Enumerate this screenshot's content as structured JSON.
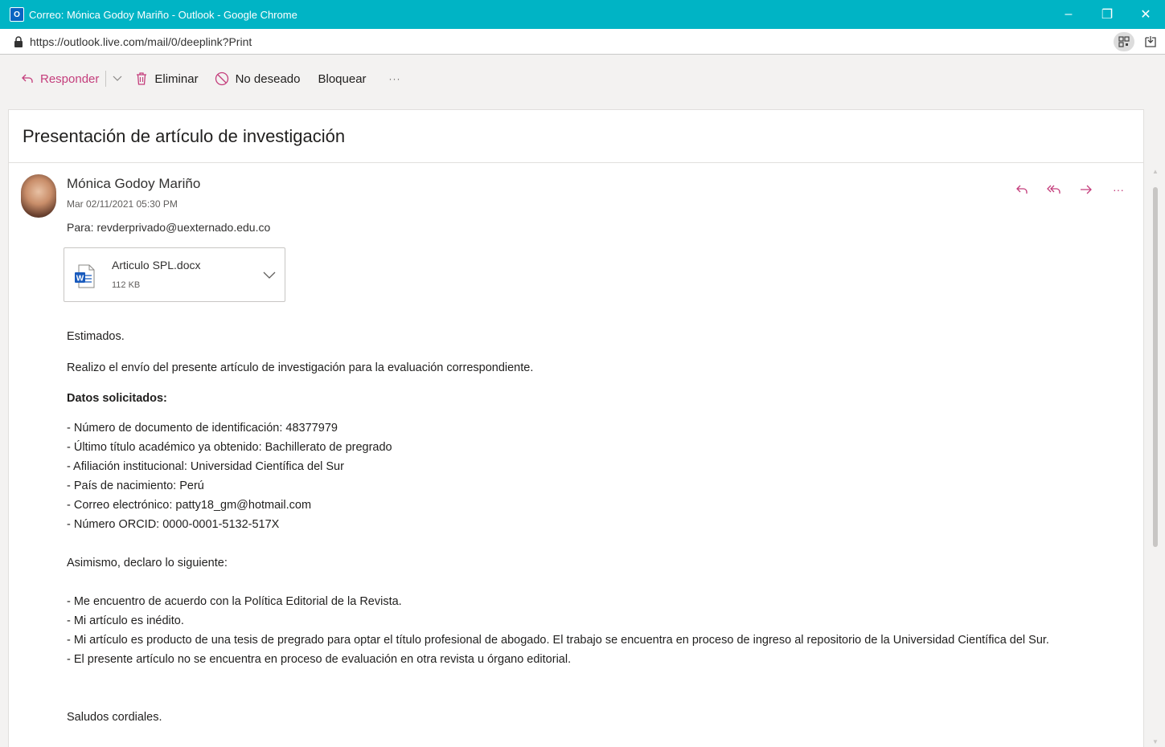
{
  "window": {
    "title": "Correo: Mónica Godoy Mariño - Outlook - Google Chrome",
    "app_icon": "O",
    "minimize": "–",
    "restore": "❐",
    "close": "✕"
  },
  "address_bar": {
    "url": "https://outlook.live.com/mail/0/deeplink?Print"
  },
  "toolbar": {
    "reply_label": "Responder",
    "delete_label": "Eliminar",
    "junk_label": "No deseado",
    "block_label": "Bloquear",
    "more_label": "···"
  },
  "message": {
    "subject": "Presentación de artículo de investigación",
    "sender": "Mónica Godoy Mariño",
    "date": "Mar 02/11/2021 05:30 PM",
    "to_label": "Para:",
    "to_value": "revderprivado@uexternado.edu.co",
    "more_actions": "···",
    "attachment": {
      "name": "Articulo SPL.docx",
      "size": "112 KB"
    },
    "body": {
      "greeting": "Estimados.",
      "intro": "Realizo el envío del presente artículo de investigación para la evaluación correspondiente.",
      "data_heading": "Datos solicitados:",
      "data_items": [
        "- Número de documento de identificación: 48377979",
        "- Último título académico ya obtenido: Bachillerato de pregrado",
        "- Afiliación institucional: Universidad Científica del Sur",
        "- País de nacimiento: Perú",
        "- Correo electrónico: patty18_gm@hotmail.com",
        "- Número ORCID: 0000-0001-5132-517X"
      ],
      "declare_heading": "Asimismo, declaro lo siguiente:",
      "declare_items": [
        "- Me encuentro de acuerdo con la Política Editorial de la Revista.",
        "- Mi artículo es inédito.",
        "- Mi artículo es producto de una tesis de pregrado para optar el título profesional de abogado. El trabajo se encuentra en proceso de ingreso al repositorio de la Universidad Científica del Sur.",
        "- El presente artículo no se encuentra en proceso de evaluación en otra revista u órgano editorial."
      ],
      "closing": "Saludos cordiales."
    }
  },
  "colors": {
    "titlebar": "#00b4c5",
    "accent": "#c43e7c",
    "word_blue": "#185abd"
  },
  "icons": {
    "reply": "reply-icon",
    "delete": "trash-icon",
    "junk": "block-circle-icon",
    "lock": "lock-icon",
    "word": "word-file-icon"
  }
}
